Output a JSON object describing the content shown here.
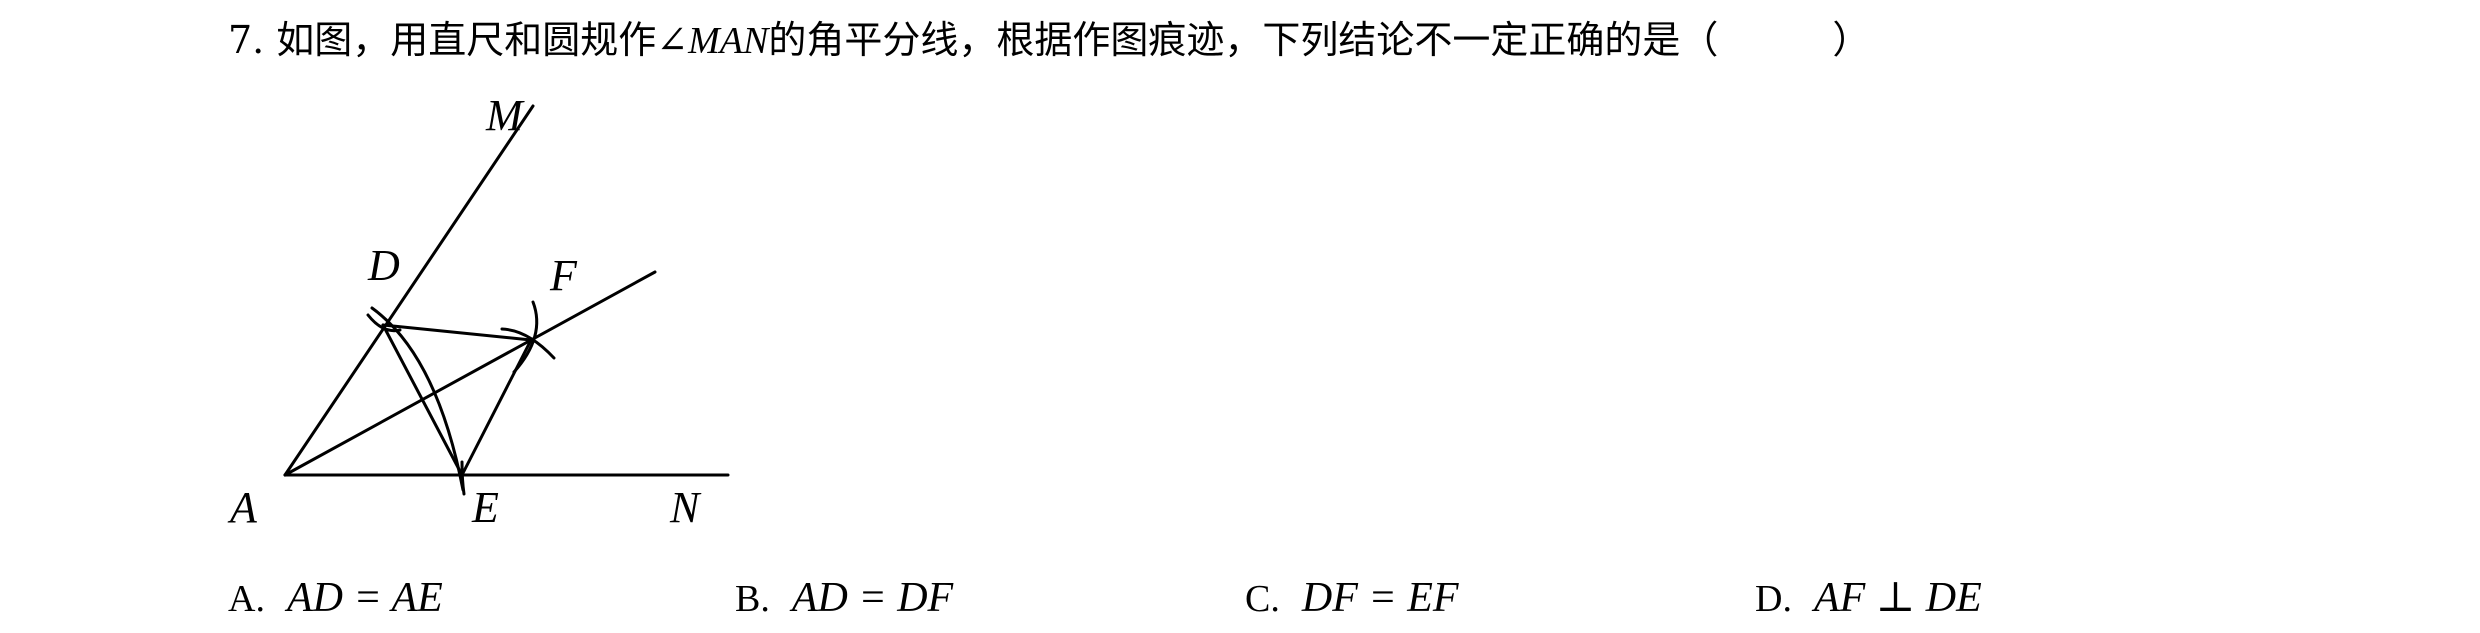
{
  "question": {
    "number": "7.",
    "text_before": "如图，用直尺和圆规作",
    "angle_symbol": "∠",
    "angle_name": "MAN",
    "text_after": "的角平分线，根据作图痕迹，下列结论不一定正确的是（　　　）"
  },
  "figure": {
    "labels": {
      "M": "M",
      "D": "D",
      "F": "F",
      "A": "A",
      "E": "E",
      "N": "N"
    }
  },
  "options": [
    {
      "letter": "A.",
      "expr": "AD = AE"
    },
    {
      "letter": "B.",
      "expr": "AD = DF"
    },
    {
      "letter": "C.",
      "expr": "DF = EF"
    },
    {
      "letter": "D.",
      "expr": "AF ⊥ DE"
    }
  ]
}
